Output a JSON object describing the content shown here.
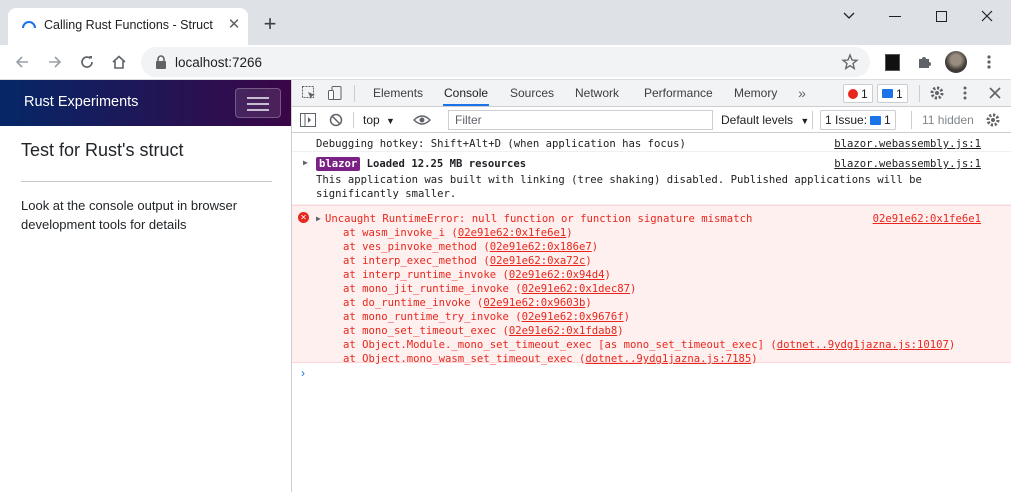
{
  "browser": {
    "tab_title": "Calling Rust Functions - Struct",
    "url": "localhost:7266"
  },
  "page": {
    "app_title": "Rust Experiments",
    "heading": "Test for Rust's struct",
    "body_text": "Look at the console output in browser development tools for details"
  },
  "devtools": {
    "tabs": [
      "Elements",
      "Console",
      "Sources",
      "Network",
      "Performance",
      "Memory"
    ],
    "active_tab": "Console",
    "error_count": "1",
    "message_count": "1",
    "context": "top",
    "filter_placeholder": "Filter",
    "levels": "Default levels",
    "issues": "1 Issue:",
    "issues_count": "1",
    "hidden": "11 hidden"
  },
  "console": {
    "line1": {
      "text": "Debugging hotkey: Shift+Alt+D (when application has focus)",
      "source": "blazor.webassembly.js:1"
    },
    "line2": {
      "badge": "blazor",
      "text": "Loaded 12.25 MB resources",
      "text2": "This application was built with linking (tree shaking) disabled. Published applications will be",
      "text3": "significantly smaller.",
      "source": "blazor.webassembly.js:1"
    },
    "error": {
      "message": "Uncaught RuntimeError: null function or function signature mismatch",
      "source": "02e91e62:0x1fe6e1",
      "stack": [
        {
          "fn": "wasm_invoke_i",
          "loc": "02e91e62:0x1fe6e1"
        },
        {
          "fn": "ves_pinvoke_method",
          "loc": "02e91e62:0x186e7"
        },
        {
          "fn": "interp_exec_method",
          "loc": "02e91e62:0xa72c"
        },
        {
          "fn": "interp_runtime_invoke",
          "loc": "02e91e62:0x94d4"
        },
        {
          "fn": "mono_jit_runtime_invoke",
          "loc": "02e91e62:0x1dec87"
        },
        {
          "fn": "do_runtime_invoke",
          "loc": "02e91e62:0x9603b"
        },
        {
          "fn": "mono_runtime_try_invoke",
          "loc": "02e91e62:0x9676f"
        },
        {
          "fn": "mono_set_timeout_exec",
          "loc": "02e91e62:0x1fdab8"
        },
        {
          "fn": "Object.Module._mono_set_timeout_exec [as mono_set_timeout_exec]",
          "loc": "dotnet..9ydg1jazna.js:10107"
        },
        {
          "fn": "Object.mono_wasm_set_timeout_exec",
          "loc": "dotnet..9ydg1jazna.js:7185"
        }
      ]
    }
  },
  "colors": {
    "accent": "#1a73e8",
    "error": "#e8271c",
    "error_bg": "#fff0f0",
    "header_from": "#052767",
    "header_to": "#3a0647"
  }
}
